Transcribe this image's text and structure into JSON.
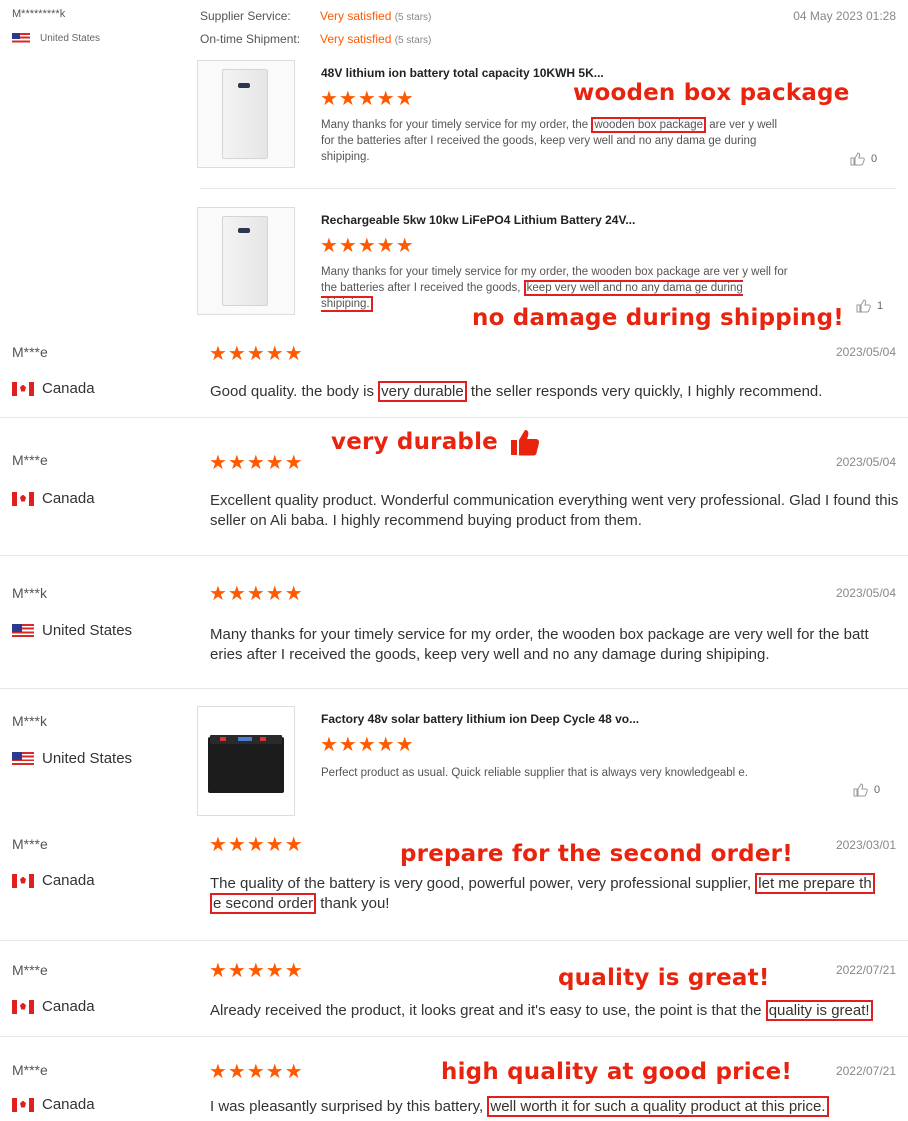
{
  "top_review": {
    "reviewer": "M*********k",
    "country": "United States",
    "supplier_service_label": "Supplier Service:",
    "supplier_service_value": "Very satisfied",
    "supplier_service_stars": "(5 stars)",
    "shipment_label": "On-time Shipment:",
    "shipment_value": "Very satisfied",
    "shipment_stars": "(5 stars)",
    "date": "04 May 2023 01:28",
    "products": [
      {
        "title": "48V lithium ion battery total capacity 10KWH 5K...",
        "rating": 5,
        "text_before": "Many thanks for your timely service for my order, the ",
        "text_highlight": "wooden box package",
        "text_after": " are ver y well for the batteries after I received the goods, keep very well and no any dama ge during shipiping.",
        "likes": "0",
        "annotation": "wooden box package"
      },
      {
        "title": "Rechargeable 5kw 10kw LiFePO4 Lithium Battery 24V...",
        "rating": 5,
        "text_before": "Many thanks for your timely service for my order, the wooden box package are ver y well for the batteries after I received the goods, ",
        "text_highlight": "keep very well and no any dama ge during shipiping.",
        "text_after": "",
        "likes": "1",
        "annotation": "no damage during shipping!"
      }
    ]
  },
  "reviews": [
    {
      "reviewer": "M***e",
      "country": "Canada",
      "date": "2023/05/04",
      "rating": 5,
      "text_before": "Good quality. the body is ",
      "text_highlight": "very durable",
      "text_after": " the seller responds very quickly, I highly recommend.",
      "annotation": "very durable"
    },
    {
      "reviewer": "M***e",
      "country": "Canada",
      "date": "2023/05/04",
      "rating": 5,
      "text": "Excellent quality product. Wonderful communication everything went very professional. Glad I found this seller on Ali baba. I highly recommend buying product from them."
    },
    {
      "reviewer": "M***k",
      "country": "United States",
      "date": "2023/05/04",
      "rating": 5,
      "text": "Many thanks for your timely service for my order, the wooden box package are very well for the batt eries after I received the goods, keep very well and no any damage during shipiping."
    },
    {
      "reviewer": "M***k",
      "country": "United States",
      "rating": 5,
      "product_title": "Factory 48v solar battery lithium ion Deep Cycle 48 vo...",
      "text": "Perfect product as usual. Quick reliable supplier that is always very knowledgeabl e.",
      "likes": "0"
    },
    {
      "reviewer": "M***e",
      "country": "Canada",
      "date": "2023/03/01",
      "rating": 5,
      "text_before": "The quality of the battery is very good, powerful power, very professional supplier, ",
      "text_highlight_1": "let me prepare th",
      "text_highlight_2": "e second order",
      "text_after": " thank you!",
      "annotation": "prepare for the second order!"
    },
    {
      "reviewer": "M***e",
      "country": "Canada",
      "date": "2022/07/21",
      "rating": 5,
      "text_before": "Already received the product, it looks great and it's easy to use, the point is that the ",
      "text_highlight": "quality is great!",
      "text_after": "",
      "annotation": "quality is great!"
    },
    {
      "reviewer": "M***e",
      "country": "Canada",
      "date": "2022/07/21",
      "rating": 5,
      "text_before": "I was pleasantly surprised by this battery, ",
      "text_highlight": "well worth it for such a quality product at this price.",
      "text_after": "",
      "annotation": "high quality at good price!"
    }
  ],
  "stars_glyph": "★★★★★",
  "colors": {
    "accent": "#ff5a00",
    "annotation": "#e8240e",
    "highlight_border": "#e02020"
  },
  "icons": [
    "flag-us-icon",
    "flag-canada-icon",
    "thumbs-up-icon",
    "like-icon"
  ]
}
